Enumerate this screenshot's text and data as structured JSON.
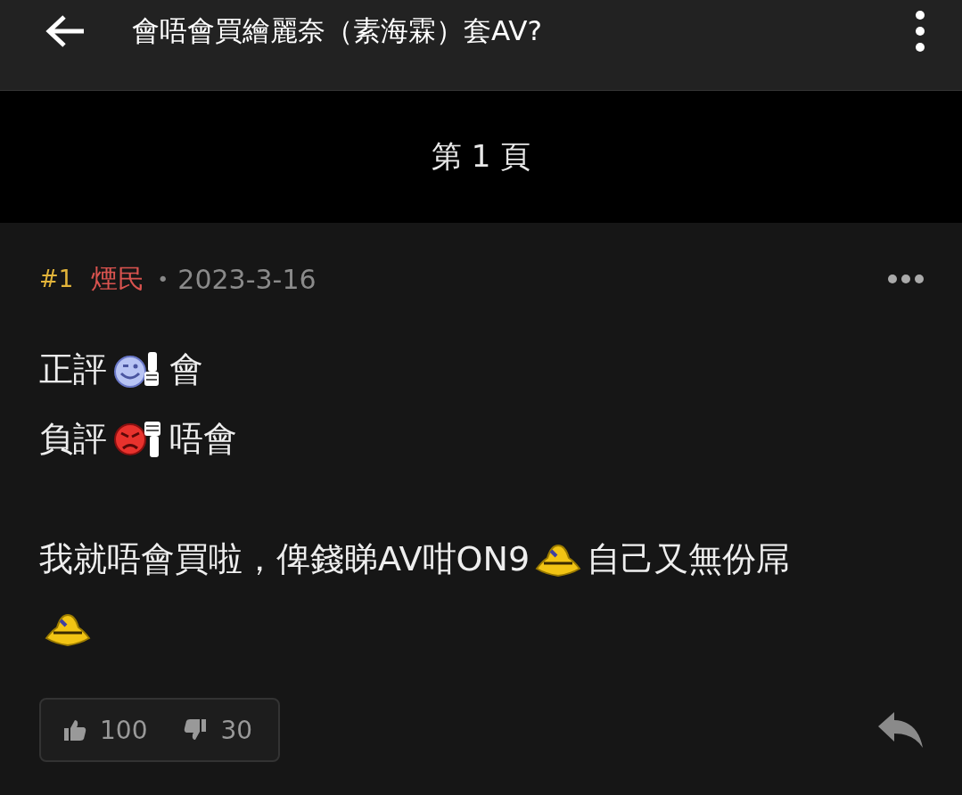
{
  "header": {
    "title": "會唔會買繪麗奈（素海霖）套AV?"
  },
  "page_banner": {
    "label": "第 1 頁"
  },
  "post": {
    "number": "#1",
    "author": "煙民",
    "separator": "•",
    "date": "2023-3-16",
    "paragraphs": [
      [
        [
          {
            "kind": "text",
            "text": "正評"
          },
          {
            "kind": "smile_up"
          },
          {
            "kind": "text",
            "text": "會"
          }
        ],
        [
          {
            "kind": "text",
            "text": "負評"
          },
          {
            "kind": "angry_down"
          },
          {
            "kind": "text",
            "text": "唔會"
          }
        ]
      ],
      [
        [
          {
            "kind": "text",
            "text": "我就唔會買啦，俾錢睇AV咁ON9"
          },
          {
            "kind": "yellow"
          },
          {
            "kind": "text",
            "text": "自己又無份屌"
          }
        ],
        [
          {
            "kind": "yellow"
          }
        ]
      ]
    ],
    "likes": "100",
    "dislikes": "30"
  }
}
